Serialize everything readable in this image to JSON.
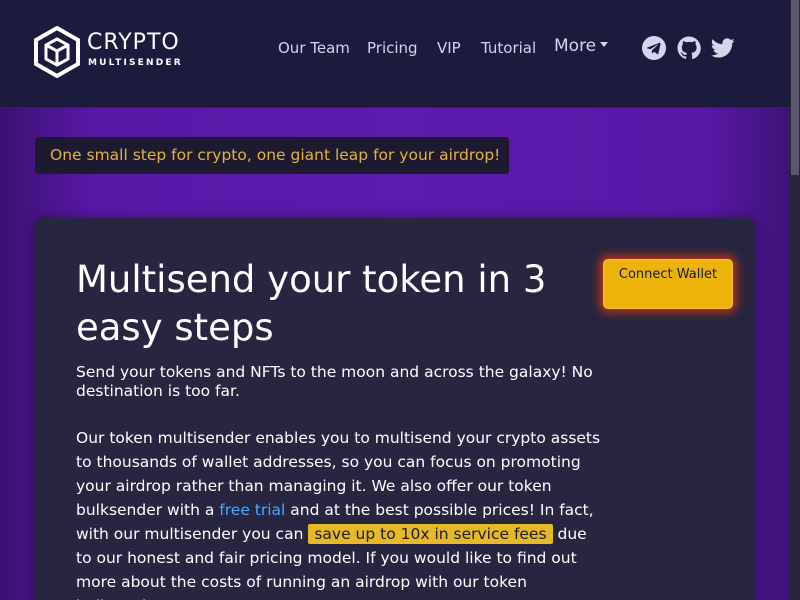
{
  "brand": {
    "name": "CRYPTO",
    "subtitle": "MULTISENDER"
  },
  "nav": {
    "items": [
      {
        "label": "Our Team"
      },
      {
        "label": "Pricing"
      },
      {
        "label": "VIP"
      },
      {
        "label": "Tutorial"
      },
      {
        "label": "More"
      }
    ],
    "social_icons": [
      "telegram-icon",
      "github-icon",
      "twitter-icon"
    ]
  },
  "tagline": "One small step for crypto, one giant leap for your airdrop!",
  "hero": {
    "title": "Multisend your token in 3 easy steps",
    "subtitle": "Send your tokens and NFTs to the moon and across the galaxy! No destination is too far.",
    "body": {
      "part1": "Our token multisender enables you to multisend your crypto assets to thousands of wallet addresses, so you can focus on promoting your airdrop rather than managing it. We also offer our token bulksender with a ",
      "link_free_trial": "free trial",
      "part2": " and at the best possible prices! In fact, with our multisender you can ",
      "highlight": "save up to 10x in service fees",
      "part3": " due to our honest and fair pricing model. If you would like to find out more about the costs of running an airdrop with our token bulksender,"
    },
    "connect_button": "Connect Wallet"
  },
  "colors": {
    "accent": "#ecb30a",
    "link": "#4aa8ff",
    "tagline_text": "#e3b341",
    "navbar_bg": "#1c1b3e",
    "card_bg": "#27253f",
    "page_bg": "#5c1aae"
  }
}
